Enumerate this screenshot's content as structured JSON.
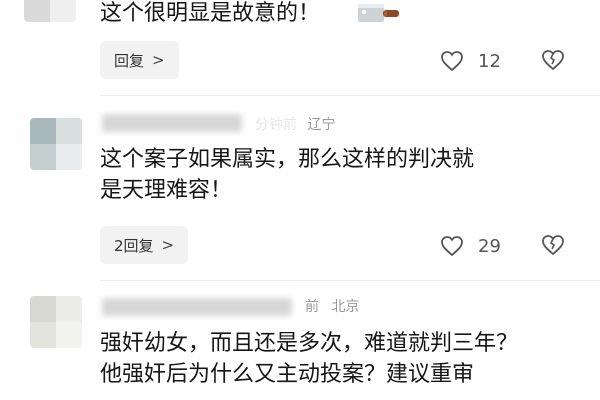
{
  "comments": [
    {
      "text_lines": [
        "这个很明显是故意的！"
      ],
      "emoji": "knife-icon",
      "reply_label": "回复",
      "like_count": "12"
    },
    {
      "meta_time_fragment": "分钟前",
      "meta_location": "辽宁",
      "text_lines": [
        "这个案子如果属实，那么这样的判决就",
        "是天理难容！"
      ],
      "reply_label": "2回复",
      "like_count": "29"
    },
    {
      "meta_time_fragment": "前",
      "meta_location": "北京",
      "text_lines": [
        "强奸幼女，而且还是多次，难道就判三年？",
        "他强奸后为什么又主动投案？建议重审"
      ]
    }
  ],
  "colors": {
    "text": "#161616",
    "meta": "#9a9a9a",
    "reply_bg": "#f2f2f2"
  }
}
